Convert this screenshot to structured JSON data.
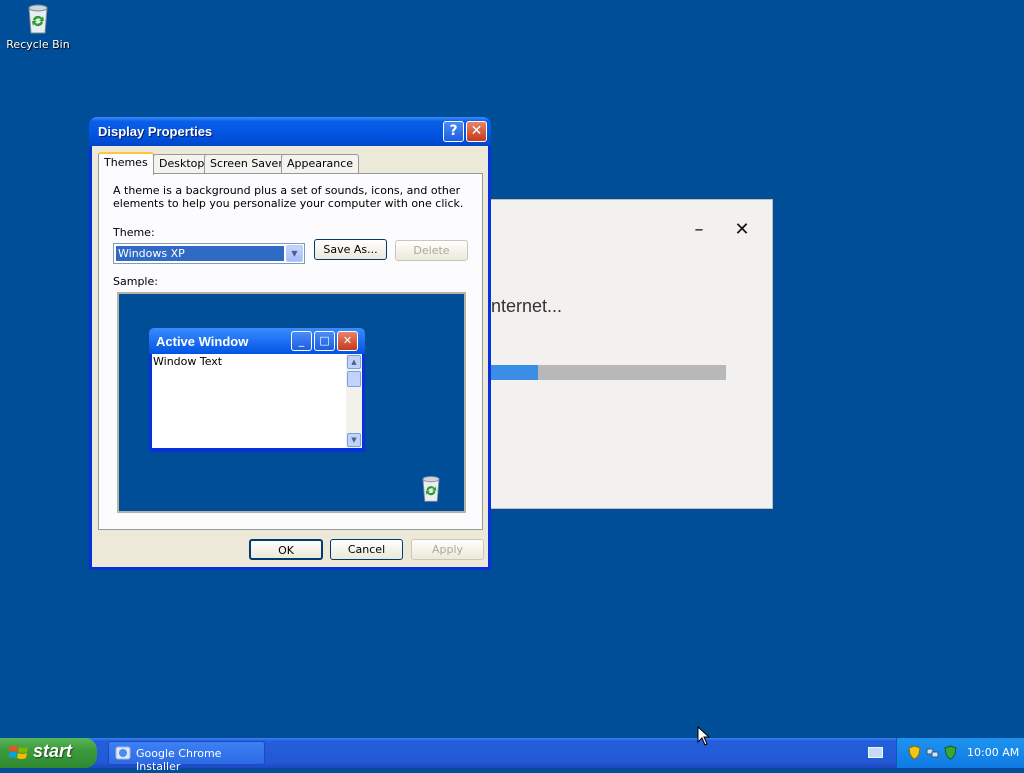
{
  "desktop": {
    "icons": [
      {
        "label": "Recycle Bin",
        "icon": "recycle-bin-icon"
      }
    ]
  },
  "installer": {
    "message": "nternet...",
    "progress": 0.2,
    "accent": "#3b8ee6"
  },
  "dialog": {
    "title": "Display Properties",
    "help_label": "?",
    "tabs": [
      {
        "label": "Themes",
        "active": true
      },
      {
        "label": "Desktop",
        "active": false
      },
      {
        "label": "Screen Saver",
        "active": false
      },
      {
        "label": "Appearance",
        "active": false
      }
    ],
    "description": "A theme is a background plus a set of sounds, icons, and other elements to help you personalize your computer with one click.",
    "theme_label": "Theme:",
    "theme_value": "Windows XP",
    "save_as_label": "Save As...",
    "delete_label": "Delete",
    "sample_label": "Sample:",
    "sample_window": {
      "title": "Active Window",
      "text": "Window Text"
    },
    "ok_label": "OK",
    "cancel_label": "Cancel",
    "apply_label": "Apply"
  },
  "taskbar": {
    "start_label": "start",
    "tasks": [
      {
        "label": "Google Chrome Installer",
        "icon": "chrome-installer-icon"
      }
    ],
    "clock": "10:00 AM"
  },
  "colors": {
    "desktop": "#004e98",
    "titlebar": "#0054e3",
    "taskbar": "#245edb",
    "start": "#3c9a3c"
  }
}
